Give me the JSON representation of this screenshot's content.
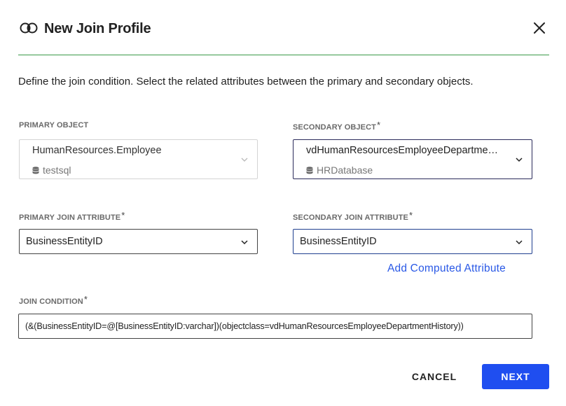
{
  "dialog": {
    "title": "New Join Profile",
    "title_icon": "join-circles-icon",
    "close_icon": "close-icon",
    "description": "Define the join condition. Select the related attributes between the primary and secondary objects.",
    "divider_color": "#3b9a48"
  },
  "primary_object": {
    "label": "PRIMARY OBJECT",
    "name": "HumanResources.Employee",
    "source": "testsql",
    "source_icon": "database-icon",
    "disabled": true
  },
  "secondary_object": {
    "label": "SECONDARY OBJECT",
    "required_mark": "*",
    "name": "vdHumanResourcesEmployeeDepartmentHistory",
    "source": "HRDatabase",
    "source_icon": "database-icon"
  },
  "primary_join_attribute": {
    "label": "PRIMARY JOIN ATTRIBUTE",
    "required_mark": "*",
    "value": "BusinessEntityID"
  },
  "secondary_join_attribute": {
    "label": "SECONDARY JOIN ATTRIBUTE",
    "required_mark": "*",
    "value": "BusinessEntityID"
  },
  "add_computed_attribute": "Add Computed Attribute",
  "join_condition": {
    "label": "JOIN CONDITION",
    "required_mark": "*",
    "value": "(&(BusinessEntityID=@[BusinessEntityID:varchar])(objectclass=vdHumanResourcesEmployeeDepartmentHistory))"
  },
  "actions": {
    "cancel": "CANCEL",
    "next": "NEXT",
    "next_color": "#1f4ef0",
    "link_color": "#2a59e6"
  }
}
